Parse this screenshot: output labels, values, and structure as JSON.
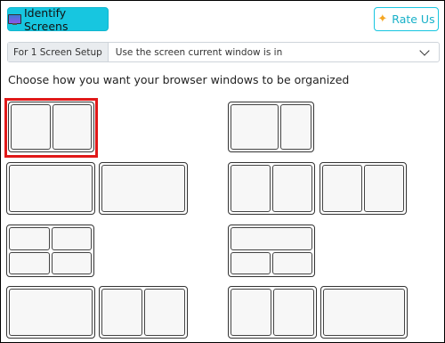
{
  "header": {
    "identify_label": "Identify Screens",
    "rate_label": "Rate Us"
  },
  "setup": {
    "label": "For 1 Screen Setup",
    "selected": "Use the screen current window is in"
  },
  "instruction": "Choose how you want your browser windows to be organized",
  "layouts": [
    {
      "id": "two-columns",
      "cols": 2,
      "rows": 1,
      "selected": true
    },
    {
      "id": "two-columns-right-narrow",
      "cols": 2,
      "rows": 1
    },
    {
      "id": "single-left",
      "cols": 1,
      "rows": 1
    },
    {
      "id": "single-right",
      "cols": 1,
      "rows": 1
    },
    {
      "id": "two-columns-b",
      "cols": 2,
      "rows": 1
    },
    {
      "id": "two-columns-c",
      "cols": 2,
      "rows": 1
    },
    {
      "id": "grid-2x2",
      "cols": 2,
      "rows": 2
    },
    {
      "id": "top-one-bottom-two",
      "cols": 2,
      "rows": 2
    },
    {
      "id": "single-d",
      "cols": 1,
      "rows": 1
    },
    {
      "id": "two-columns-d",
      "cols": 2,
      "rows": 1
    },
    {
      "id": "two-columns-e",
      "cols": 2,
      "rows": 1
    },
    {
      "id": "single-e",
      "cols": 1,
      "rows": 1
    }
  ],
  "colors": {
    "accent": "#17c6e0",
    "selection": "#e01818"
  }
}
